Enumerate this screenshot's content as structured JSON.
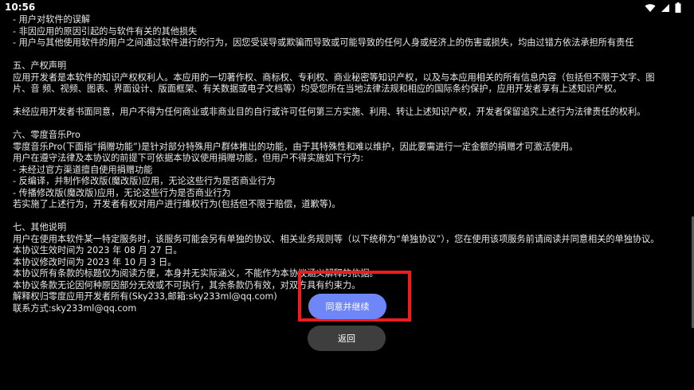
{
  "status_bar": {
    "time": "10:56",
    "icons": [
      "wifi-icon",
      "signal-icon",
      "battery-icon"
    ]
  },
  "content": {
    "lines": [
      "- 用户对软件的误解",
      "- 非因应用的原因引起的与软件有关的其他损失",
      "- 用户与其他使用软件的用户之间通过软件进行的行为，因您受误导或欺骗而导致或可能导致的任何人身或经济上的伤害或损失，均由过错方依法承担所有责任",
      "",
      "五、产权声明",
      "应用开发者是本软件的知识产权权利人。本应用的一切著作权、商标权、专利权、商业秘密等知识产权，以及与本应用相关的所有信息内容（包括但不限于文字、图",
      "片、音 频、视频、图表、界面设计、版面框架、有关数据或电子文档等）均受您所在当地法律法规和相应的国际条约保护，应用开发者享有上述知识产权。",
      "",
      "未经应用开发者书面同意，用户不得为任何商业或非商业目的自行或许可任何第三方实施、利用、转让上述知识产权，开发者保留追究上述行为法律责任的权利。",
      "",
      "六、零度音乐Pro",
      "零度音乐Pro(下面指“捐赠功能”)是针对部分特殊用户群体推出的功能，由于其特殊性和难以维护，因此要需进行一定金额的捐赠才可激活使用。",
      "用户在遵守法律及本协议的前提下可依据本协议使用捐赠功能，但用户不得实施如下行为:",
      "- 未经过官方渠道擅自使用捐赠功能",
      "- 反编译，并制作修改版(魔改版)应用，无论这些行为是否商业行为",
      "- 传播修改版(魔改版)应用，无论这些行为是否商业行为",
      "若实施了上述行为，开发者有权对用户进行维权行为(包括但不限于赔偿，道歉等)。",
      "",
      "七、其他说明",
      "用户在使用本软件某一特定服务时，该服务可能会另有单独的协议、相关业务规则等（以下统称为“单独协议”），您在使用该项服务前请阅读并同意相关的单独协议。",
      "本协议生效时间为 2023 年 08 月 27 日。",
      "本协议修改时间为 2023 年 10 月 3 日。",
      "本协议所有条款的标题仅为阅读方便，本身并无实际涵义，不能作为本协议涵义解释的依据。",
      "本协议条款无论因何种原因部分无效或不可执行，其余条款仍有效，对双方具有约束力。",
      "解释权归零度应用开发者所有(Sky233,邮箱:sky233ml@qq.com)",
      "联系方式:sky233ml@qq.com"
    ]
  },
  "buttons": {
    "agree_label": "同意并继续",
    "back_label": "返回"
  },
  "colors": {
    "agree_button": "#6f86f8",
    "back_button": "#3e3e3e",
    "highlight": "#ee1c1c"
  }
}
